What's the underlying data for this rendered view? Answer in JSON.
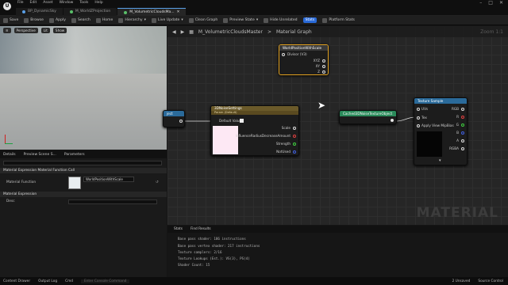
{
  "app": {
    "menu": [
      "File",
      "Edit",
      "Asset",
      "Window",
      "Tools",
      "Help"
    ],
    "tabs": [
      "BP_DynamicSky",
      "M_WorldZProjection",
      "M_VolumetricCloudsMa..."
    ]
  },
  "toolbar": {
    "save": "Save",
    "browse": "Browse",
    "apply": "Apply",
    "search": "Search",
    "home": "Home",
    "hierarchy": "Hierarchy",
    "live_update": "Live Update",
    "clean_graph": "Clean Graph",
    "preview_state": "Preview State",
    "hide_unrelated": "Hide Unrelated",
    "stats": "Stats",
    "platform_stats": "Platform Stats"
  },
  "viewport": {
    "perspective": "Perspective",
    "lit": "Lit",
    "show": "Show"
  },
  "details": {
    "tabs": [
      "Details",
      "Preview Scene S...",
      "Parameters"
    ],
    "section1": "Material Expression Material Function Call",
    "material_function_label": "Material Function",
    "material_function_value": "WorldPositionWithScale",
    "section2": "Material Expression",
    "desc_label": "Desc"
  },
  "graph": {
    "breadcrumb": "M_VolumetricCloudsMaster",
    "breadcrumb_sep": ">",
    "breadcrumb2": "Material Graph",
    "zoom": "Zoom 1:1",
    "watermark": "MATERIAL",
    "node_wp": {
      "title": "WorldPositionWithScale",
      "pins": [
        "Divisor (V3)",
        "XYZ",
        "XY",
        "Z"
      ]
    },
    "node_noise": {
      "title": "3DNoiseSettings",
      "subtitle": "Param (Default)",
      "default": "Default Value",
      "outs": [
        "Scale",
        "InfluenceRadiusDecreaseAmount",
        "Strength",
        "NotUsed"
      ]
    },
    "node_cached": {
      "title": "Cached3DNoiseTextureObject"
    },
    "node_tex": {
      "title": "Texture Sample",
      "ins": [
        "UVs",
        "Tex",
        "Apply View MipBias"
      ],
      "outs": [
        "RGB",
        "R",
        "G",
        "B",
        "A",
        "RGBA"
      ]
    },
    "node_left": {
      "title": "ject"
    }
  },
  "stats": {
    "tabs": [
      "Stats",
      "Find Results"
    ],
    "lines": [
      "Base pass shader: 186 instructions",
      "Base pass vertex shader: 217 instructions",
      "Texture samplers: 2/16",
      "Texture Lookups (Est.): VS(3), PS(4)",
      "Shader Count: 15"
    ]
  },
  "status": {
    "items": [
      "Content Drawer",
      "Output Log",
      "Cmd"
    ],
    "cmd_placeholder": "Enter Console Command",
    "unsaved": "2 Unsaved",
    "source_control": "Source Control"
  },
  "colors": {
    "accent": "#2a6ad8",
    "node_wp_border": "#e0a020",
    "node_noise_header": "#6b5a2a",
    "node_cached_header": "#2a8a5a",
    "node_tex_header": "#2a6a9a"
  }
}
